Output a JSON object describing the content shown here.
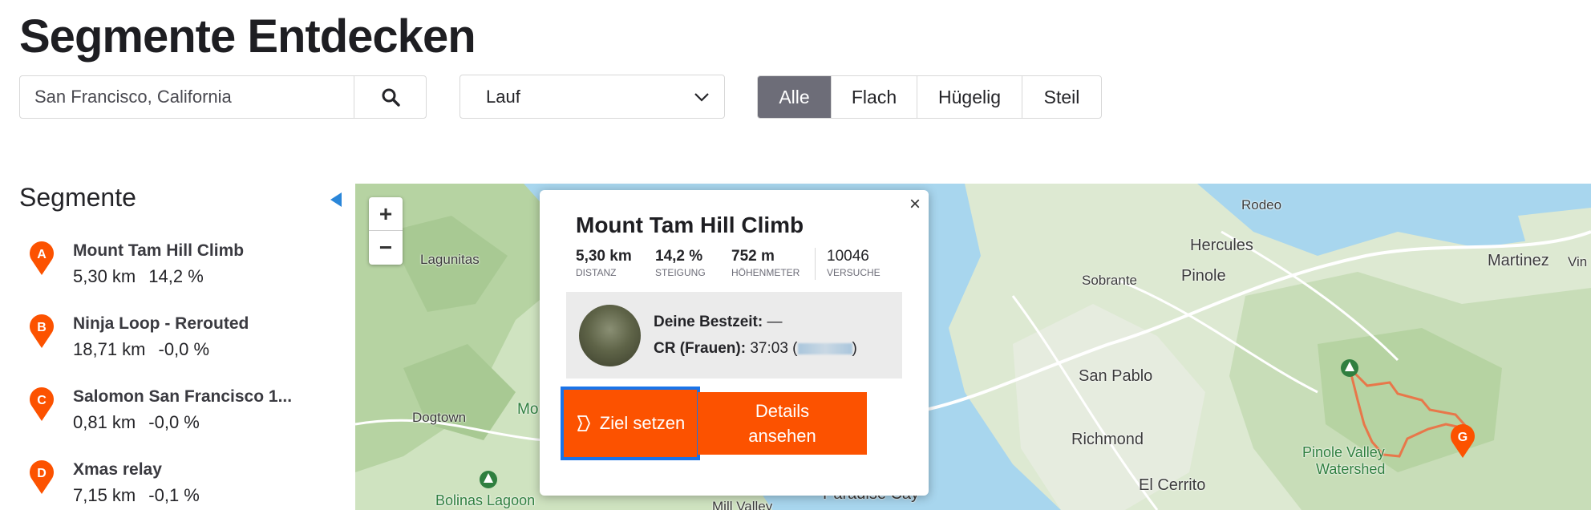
{
  "page": {
    "title": "Segmente Entdecken"
  },
  "search": {
    "value": "San Francisco, California",
    "icon": "search-icon"
  },
  "sport_select": {
    "value": "Lauf",
    "icon": "chevron-down-icon"
  },
  "terrain_filter": {
    "options": [
      "Alle",
      "Flach",
      "Hügelig",
      "Steil"
    ],
    "selected": "Alle",
    "active_color": "#6d6d78"
  },
  "sidebar": {
    "heading": "Segmente",
    "collapse_icon": "triangle-left-icon",
    "segments": [
      {
        "marker": "A",
        "name": "Mount Tam Hill Climb",
        "distance": "5,30 km",
        "grade": "14,2 %"
      },
      {
        "marker": "B",
        "name": "Ninja Loop - Rerouted",
        "distance": "18,71 km",
        "grade": "-0,0 %"
      },
      {
        "marker": "C",
        "name": "Salomon San Francisco 1...",
        "distance": "0,81 km",
        "grade": "-0,0 %"
      },
      {
        "marker": "D",
        "name": "Xmas relay",
        "distance": "7,15 km",
        "grade": "-0,1 %"
      }
    ],
    "marker_color": "#fc5200"
  },
  "map": {
    "zoom_in": "+",
    "zoom_out": "−",
    "labels": {
      "lagunitas": "Lagunitas",
      "rodeo": "Rodeo",
      "hercules": "Hercules",
      "martinez": "Martinez",
      "vin": "Vin",
      "sobrante": "Sobrante",
      "pinole": "Pinole",
      "san_pablo": "San Pablo",
      "dogtown": "Dogtown",
      "mo": "Mo",
      "richmond": "Richmond",
      "el_cerrito": "El Cerrito",
      "pinole_valley_1": "Pinole Valley",
      "pinole_valley_2": "Watershed",
      "bolinas_lagoon": "Bolinas Lagoon",
      "mill_valley": "Mill Valley",
      "paradise_cay": "Paradise Cay"
    },
    "route_marker": "G",
    "water_color": "#a8d6ee",
    "land_color": "#dde9d2",
    "route_color": "#e8774a"
  },
  "popup": {
    "title": "Mount Tam Hill Climb",
    "close": "×",
    "stats": [
      {
        "value": "5,30 km",
        "label": "DISTANZ"
      },
      {
        "value": "14,2 %",
        "label": "STEIGUNG"
      },
      {
        "value": "752 m",
        "label": "HÖHENMETER"
      },
      {
        "value": "10046",
        "label": "VERSUCHE"
      }
    ],
    "best_time_label": "Deine Bestzeit:",
    "best_time_value": "—",
    "cr_label": "CR (Frauen):",
    "cr_time": "37:03 (",
    "cr_close": ")",
    "goal_button": "Ziel setzen",
    "goal_icon": "target-flag-icon",
    "details_button_line1": "Details",
    "details_button_line2": "ansehen",
    "accent_color": "#fc5200",
    "focus_color": "#1a73e8"
  }
}
